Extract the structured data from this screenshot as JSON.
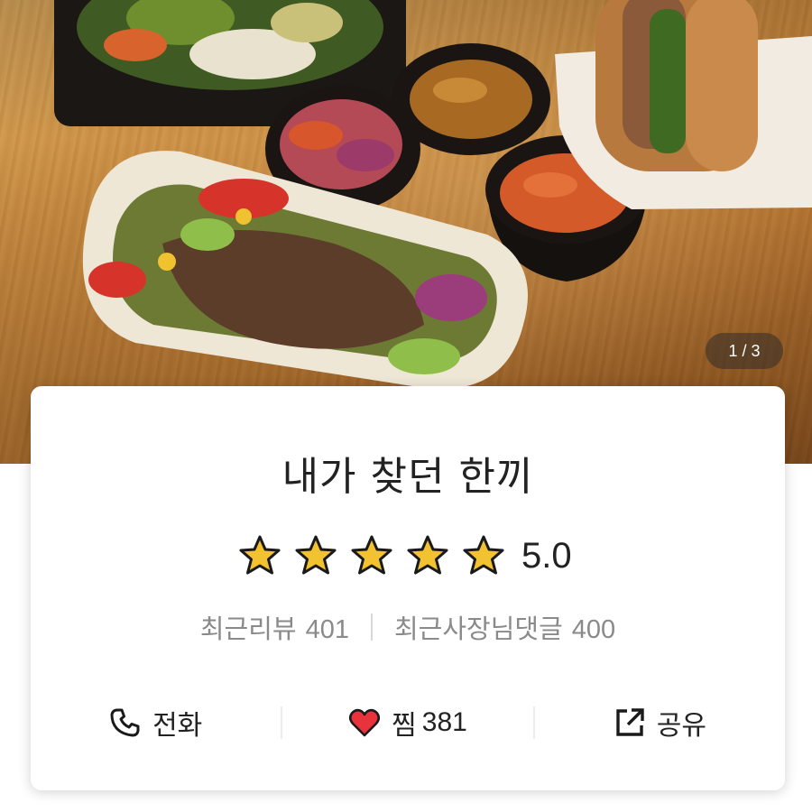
{
  "photo": {
    "page_indicator": "1 / 3"
  },
  "store": {
    "name": "내가 찾던 한끼",
    "rating": "5.0",
    "stars_filled": 5,
    "stars_total": 5
  },
  "reviews": {
    "recent_review_label": "최근리뷰",
    "recent_review_count": "401",
    "owner_reply_label": "최근사장님댓글",
    "owner_reply_count": "400"
  },
  "actions": {
    "call_label": "전화",
    "call_icon": "phone-icon",
    "like_label": "찜",
    "like_count": "381",
    "like_icon": "heart-icon",
    "share_label": "공유",
    "share_icon": "share-icon"
  },
  "colors": {
    "star": "#f2c230",
    "heart": "#e8323c",
    "text_primary": "#222222",
    "text_secondary": "#8a8a8a"
  }
}
